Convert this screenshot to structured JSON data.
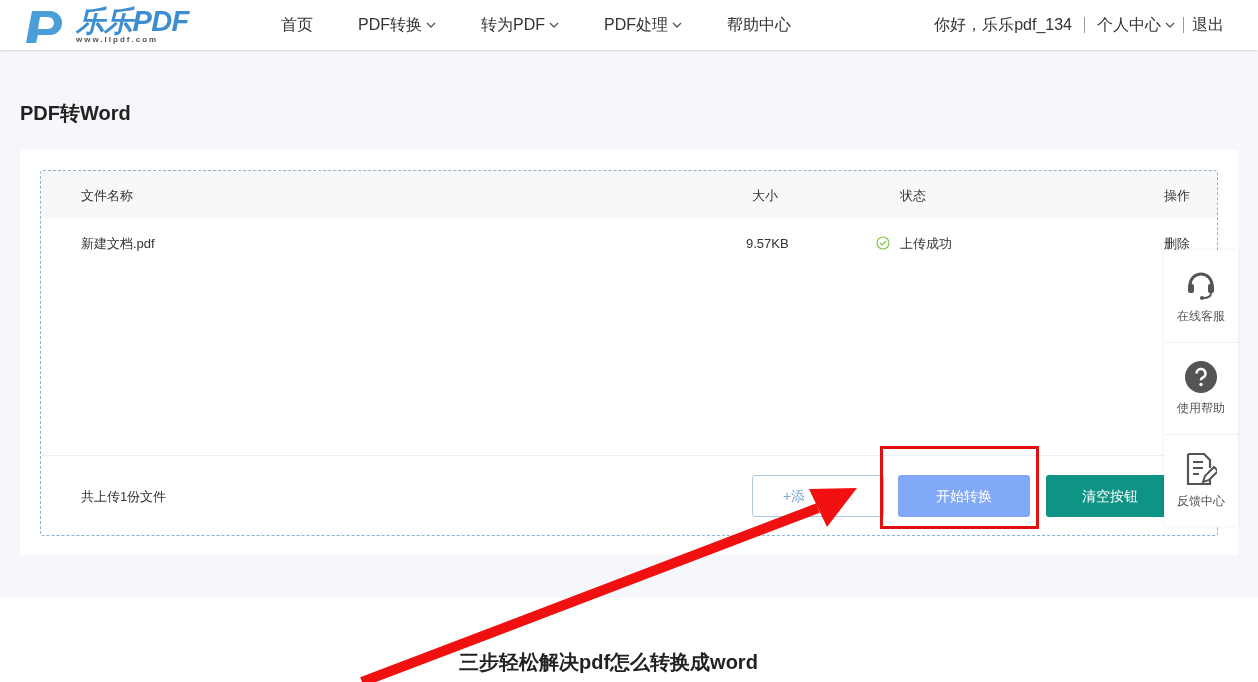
{
  "logo": {
    "name": "乐乐PDF",
    "url": "www.llpdf.com"
  },
  "nav": [
    {
      "label": "首页",
      "dropdown": false
    },
    {
      "label": "PDF转换",
      "dropdown": true
    },
    {
      "label": "转为PDF",
      "dropdown": true
    },
    {
      "label": "PDF处理",
      "dropdown": true
    },
    {
      "label": "帮助中心",
      "dropdown": false
    }
  ],
  "user": {
    "greeting": "你好，乐乐pdf_134",
    "account": "个人中心",
    "logout": "退出"
  },
  "page_title": "PDF转Word",
  "table": {
    "columns": [
      "文件名称",
      "大小",
      "状态",
      "操作"
    ],
    "rows": [
      {
        "name": "新建文档.pdf",
        "size": "9.57KB",
        "status": "上传成功",
        "action": "删除"
      }
    ]
  },
  "footer": {
    "count": "共上传1份文件",
    "add_button": "+添",
    "convert_button": "开始转换",
    "clear_button": "清空按钮"
  },
  "side_panel": [
    {
      "kind": "headset",
      "label": "在线客服"
    },
    {
      "kind": "help",
      "label": "使用帮助"
    },
    {
      "kind": "feedback",
      "label": "反馈中心"
    }
  ],
  "section_heading": "三步轻松解决pdf怎么转换成word"
}
